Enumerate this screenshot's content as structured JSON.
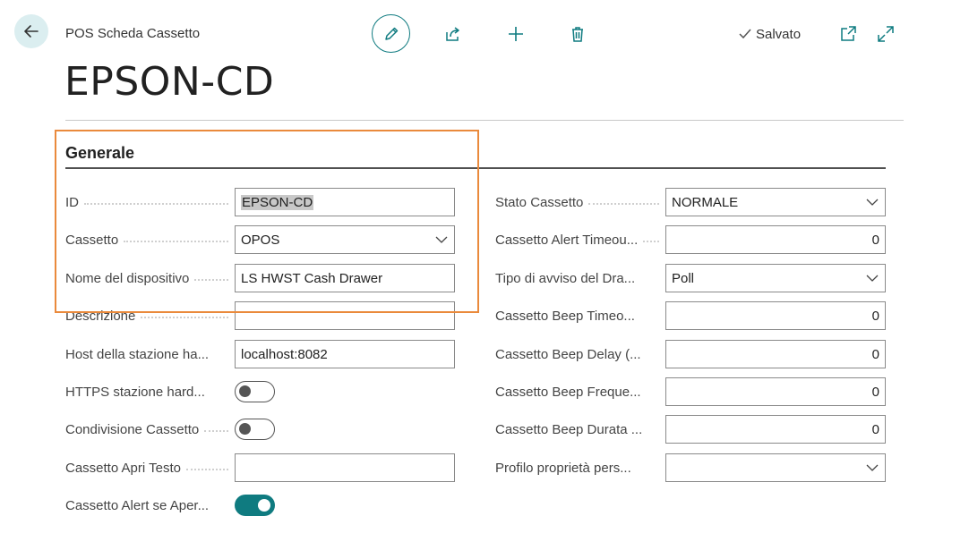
{
  "header": {
    "breadcrumb": "POS Scheda Cassetto",
    "saved_label": "Salvato"
  },
  "page_title": "EPSON-CD",
  "section_title": "Generale",
  "colors": {
    "accent": "#0f7b80",
    "highlight": "#ea8a3c",
    "back_bg": "#dbeef0"
  },
  "icons": [
    "back-arrow-icon",
    "edit-icon",
    "share-icon",
    "new-icon",
    "delete-icon",
    "check-icon",
    "open-in-new-window-icon",
    "expand-icon",
    "chevron-down-icon"
  ],
  "left": {
    "id": {
      "label": "ID",
      "value": "EPSON-CD"
    },
    "cassetto": {
      "label": "Cassetto",
      "value": "OPOS"
    },
    "nome": {
      "label": "Nome del dispositivo",
      "value": "LS HWST Cash Drawer"
    },
    "descrizione": {
      "label": "Descrizione",
      "value": ""
    },
    "host": {
      "label": "Host della stazione ha...",
      "value": "localhost:8082"
    },
    "https": {
      "label": "HTTPS stazione hard...",
      "enabled": false
    },
    "condivisione": {
      "label": "Condivisione Cassetto",
      "enabled": false
    },
    "apri_testo": {
      "label": "Cassetto Apri Testo",
      "value": ""
    },
    "alert_aperto": {
      "label": "Cassetto Alert se Aper...",
      "enabled": true
    }
  },
  "right": {
    "stato": {
      "label": "Stato Cassetto",
      "value": "NORMALE"
    },
    "alert_timeout": {
      "label": "Cassetto Alert Timeou...",
      "value": "0"
    },
    "tipo_avviso": {
      "label": "Tipo di avviso del Dra...",
      "value": "Poll"
    },
    "beep_timeout": {
      "label": "Cassetto Beep Timeo...",
      "value": "0"
    },
    "beep_delay": {
      "label": "Cassetto Beep Delay (...",
      "value": "0"
    },
    "beep_freq": {
      "label": "Cassetto Beep Freque...",
      "value": "0"
    },
    "beep_durata": {
      "label": "Cassetto Beep Durata ...",
      "value": "0"
    },
    "profilo": {
      "label": "Profilo proprietà pers...",
      "value": ""
    }
  }
}
